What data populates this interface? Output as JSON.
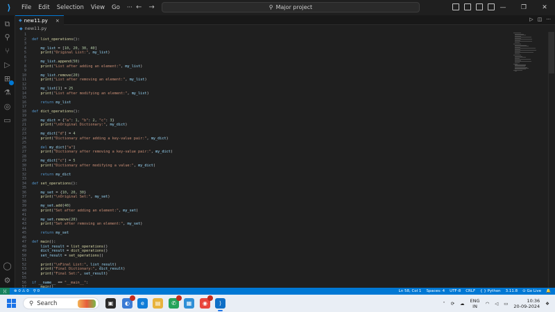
{
  "titlebar": {
    "menu": [
      "File",
      "Edit",
      "Selection",
      "View",
      "Go",
      "···"
    ],
    "search_text": "Major project",
    "window_controls": [
      "—",
      "❐",
      "✕"
    ]
  },
  "tab": {
    "filename": "new11.py",
    "close": "×",
    "lang_glyph": "◆"
  },
  "breadcrumb": {
    "file": "new11.py"
  },
  "code_lines": [
    "",
    "def list_operations():",
    "",
    "    my_list = [10, 20, 30, 40]",
    "    print(\"Original List:\", my_list)",
    "",
    "    my_list.append(50)",
    "    print(\"List after adding an element:\", my_list)",
    "",
    "    my_list.remove(20)",
    "    print(\"List after removing an element:\", my_list)",
    "",
    "    my_list[1] = 25",
    "    print(\"List after modifying an element:\", my_list)",
    "",
    "    return my_list",
    "",
    "def dict_operations():",
    "",
    "    my_dict = {\"a\": 1, \"b\": 2, \"c\": 3}",
    "    print(\"\\nOriginal Dictionary:\", my_dict)",
    "",
    "    my_dict[\"d\"] = 4",
    "    print(\"Dictionary after adding a key-value pair:\", my_dict)",
    "",
    "    del my_dict[\"a\"]",
    "    print(\"Dictionary after removing a key-value pair:\", my_dict)",
    "",
    "    my_dict[\"c\"] = 5",
    "    print(\"Dictionary after modifying a value:\", my_dict)",
    "",
    "    return my_dict",
    "",
    "def set_operations():",
    "",
    "    my_set = {10, 20, 30}",
    "    print(\"\\nOriginal Set:\", my_set)",
    "",
    "    my_set.add(40)",
    "    print(\"Set after adding an element:\", my_set)",
    "",
    "    my_set.remove(20)",
    "    print(\"Set after removing an element:\", my_set)",
    "",
    "    return my_set",
    "",
    "def main():",
    "    list_result = list_operations()",
    "    dict_result = dict_operations()",
    "    set_result = set_operations()",
    "",
    "    print(\"\\nFinal List:\", list_result)",
    "    print(\"Final Dictionary:\", dict_result)",
    "    print(\"Final Set:\", set_result)",
    "",
    "if __name__ == \"__main__\":",
    "    main()"
  ],
  "statusbar": {
    "remote": "⟩⟨",
    "errors": "⊗ 0 ⚠ 0",
    "ports": "⚲ 0",
    "position": "Ln 58, Col 1",
    "spaces": "Spaces: 4",
    "encoding": "UTF-8",
    "eol": "CRLF",
    "language": "{ } Python",
    "interpreter": "3.11.8",
    "golive": "⊙ Go Live",
    "bell": "🔔"
  },
  "taskbar": {
    "search_placeholder": "Search",
    "lang_top": "ENG",
    "lang_bottom": "IN",
    "time": "10:36",
    "date": "20-09-2024"
  },
  "colors": {
    "accent": "#0078d4",
    "editor_bg": "#1f1f1f",
    "keyword": "#569cd6",
    "function": "#dcdcaa",
    "string": "#ce9178"
  }
}
